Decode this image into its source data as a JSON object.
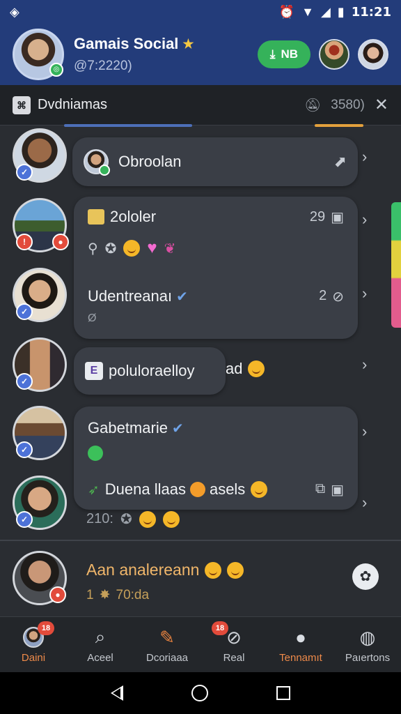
{
  "status_bar": {
    "left_icon": "diamond-signal-icon",
    "time": "11:21"
  },
  "header": {
    "title": "Gamais Social",
    "subtitle": "@7:2220)",
    "action_label": "NB"
  },
  "filter_bar": {
    "label": "Dvdniamas",
    "count": "3580)"
  },
  "chats": [
    {
      "title": "Obroolan"
    },
    {
      "title": "2ololer",
      "meta": "29"
    },
    {
      "title": "Udentreanaı",
      "sub": "Ø",
      "count": "2"
    },
    {
      "title": "poluloraelloy",
      "tail": "ad"
    },
    {
      "title": "Gabetmarie"
    },
    {
      "title": "Duena llaas",
      "tail": "asels"
    }
  ],
  "row6": {
    "time": "210:"
  },
  "last_row": {
    "name": "Aan analereann",
    "prefix": "1",
    "time": "70:da"
  },
  "tabs": [
    {
      "label": "Daini",
      "badge": "18"
    },
    {
      "label": "Aceel"
    },
    {
      "label": "Dcoriaaa"
    },
    {
      "label": "Real",
      "badge": "18"
    },
    {
      "label": "Tennamıt"
    },
    {
      "label": "Paıertons"
    }
  ],
  "colors": {
    "header_bg": "#233c7a",
    "accent_green": "#35b25a",
    "active_tab": "#ee8a4a",
    "highlight_name": "#f0b66a"
  }
}
